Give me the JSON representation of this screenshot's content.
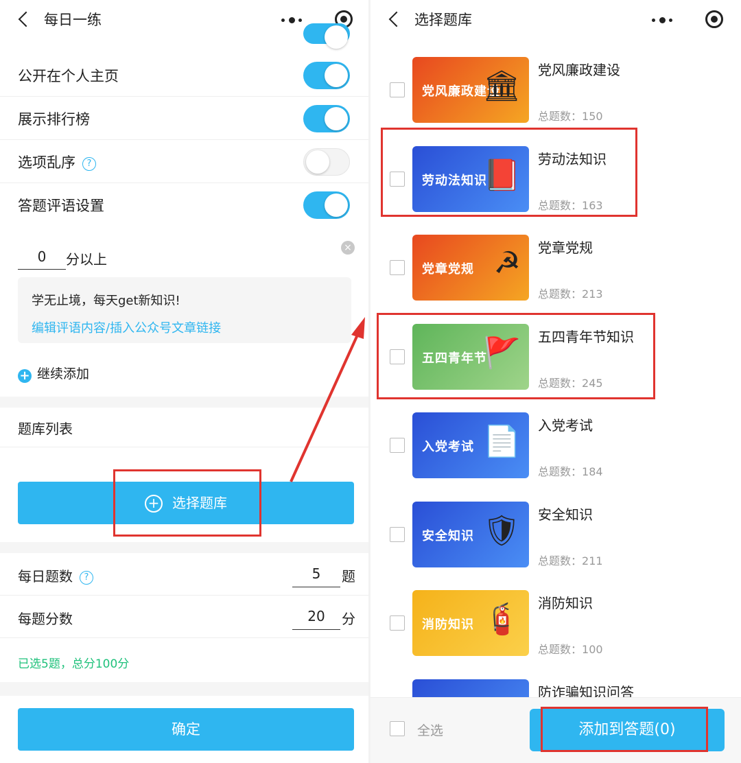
{
  "left": {
    "nav": {
      "title": "每日一练"
    },
    "settings": [
      {
        "label": "公开在个人主页",
        "on": true
      },
      {
        "label": "展示排行榜",
        "on": true
      },
      {
        "label": "选项乱序",
        "on": false,
        "help": "?"
      },
      {
        "label": "答题评语设置",
        "on": true
      }
    ],
    "comment": {
      "score_value": "0",
      "score_suffix": "分以上",
      "remove": "×",
      "text": "学无止境，每天get新知识!",
      "link": "编辑评语内容/插入公众号文章链接",
      "add_more_icon": "+",
      "add_more": "继续添加"
    },
    "bank_list_title": "题库列表",
    "select_bank_icon": "+",
    "select_bank_button": "选择题库",
    "daily_count": {
      "label": "每日题数",
      "help": "?",
      "value": "5",
      "unit": "题"
    },
    "per_score": {
      "label": "每题分数",
      "value": "20",
      "unit": "分"
    },
    "summary": "已选5题，总分100分",
    "confirm": "确定"
  },
  "right": {
    "nav": {
      "title": "选择题库"
    },
    "count_prefix": "总题数：",
    "banks": [
      {
        "name": "党风廉政建设",
        "thumb_text": "党风廉政建设",
        "count": "150",
        "art": "🏛",
        "colors": [
          "#e8481f",
          "#f5a623"
        ]
      },
      {
        "name": "劳动法知识",
        "thumb_text": "劳动法知识",
        "count": "163",
        "art": "📕",
        "colors": [
          "#2a4fd6",
          "#4a8ef5"
        ]
      },
      {
        "name": "党章党规",
        "thumb_text": "党章党规",
        "count": "213",
        "art": "☭",
        "colors": [
          "#e8481f",
          "#f5a623"
        ]
      },
      {
        "name": "五四青年节知识",
        "thumb_text": "五四青年节",
        "count": "245",
        "art": "🚩",
        "colors": [
          "#5fb55a",
          "#9fd48a"
        ]
      },
      {
        "name": "入党考试",
        "thumb_text": "入党考试",
        "count": "184",
        "art": "📄",
        "colors": [
          "#2a4fd6",
          "#4a8ef5"
        ]
      },
      {
        "name": "安全知识",
        "thumb_text": "安全知识",
        "count": "211",
        "art": "🛡",
        "colors": [
          "#2a4fd6",
          "#4a8ef5"
        ]
      },
      {
        "name": "消防知识",
        "thumb_text": "消防知识",
        "count": "100",
        "art": "🧯",
        "colors": [
          "#f5b21a",
          "#fbd04a"
        ]
      },
      {
        "name": "防诈骗知识问答",
        "thumb_text": "",
        "count": "",
        "art": "",
        "colors": [
          "#2a4fd6",
          "#4a8ef5"
        ]
      }
    ],
    "select_all": "全选",
    "add_button": "添加到答题(0)"
  },
  "colors": {
    "accent": "#2fb6f0",
    "highlight": "#e0342f",
    "success": "#1fc17b"
  }
}
